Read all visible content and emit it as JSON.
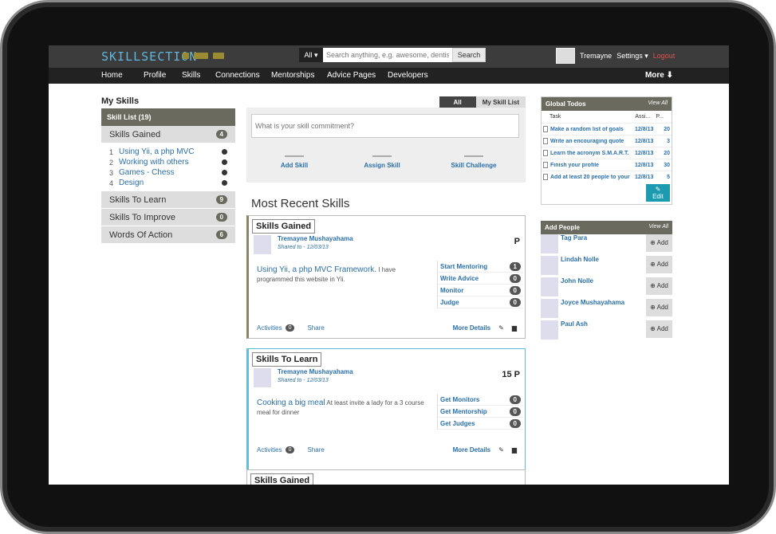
{
  "header": {
    "logo_text": "SKILLSECTION",
    "search_scope": "All ▾",
    "search_placeholder": "Search anything, e.g. awesome, dentist",
    "search_button": "Search",
    "username": "Tremayne",
    "settings": "Settings ▾",
    "logout": "Logout"
  },
  "nav": {
    "items": [
      "Home",
      "Profile",
      "Skills",
      "Connections",
      "Mentorships",
      "Advice Pages",
      "Developers"
    ],
    "more": "More ⬇"
  },
  "left": {
    "title": "My Skills",
    "list_head": "Skill List (19)",
    "groups": [
      {
        "label": "Skills Gained",
        "count": "4"
      },
      {
        "label": "Skills To Learn",
        "count": "9"
      },
      {
        "label": "Skills To Improve",
        "count": "0"
      },
      {
        "label": "Words Of Action",
        "count": "6"
      }
    ],
    "sub_items": [
      {
        "num": "1",
        "label": "Using Yii, a php MVC"
      },
      {
        "num": "2",
        "label": "Working with others"
      },
      {
        "num": "3",
        "label": "Games - Chess"
      },
      {
        "num": "4",
        "label": "Design"
      }
    ]
  },
  "middle": {
    "toggle_all": "All",
    "toggle_my": "My Skill List",
    "commit_placeholder": "What is your skill commitment?",
    "actions": [
      "Add Skill",
      "Assign Skill",
      "Skill Challenge"
    ],
    "recent_title": "Most Recent Skills",
    "cards": [
      {
        "tag": "Skills Gained",
        "name": "Tremayne Mushayahama",
        "shared": "Shared to - 12/03/13",
        "pin": "P",
        "title": "Using Yii, a php MVC Framework.",
        "body": " I have programmed this website in Yii.",
        "options": [
          {
            "label": "Start Mentoring",
            "count": "1"
          },
          {
            "label": "Write Advice",
            "count": "0"
          },
          {
            "label": "Monitor",
            "count": "0"
          },
          {
            "label": "Judge",
            "count": "0"
          }
        ],
        "activities": "Activities",
        "activities_count": "0",
        "share": "Share",
        "more": "More Details"
      },
      {
        "tag": "Skills To Learn",
        "name": "Tremayne Mushayahama",
        "shared": "Shared to - 12/03/13",
        "pin": "15 P",
        "title": "Cooking a big meal",
        "body": " At least invite a lady for a 3 course meal for dinner",
        "options": [
          {
            "label": "Get Monitors",
            "count": "0"
          },
          {
            "label": "Get Mentorship",
            "count": "0"
          },
          {
            "label": "Get Judges",
            "count": "0"
          }
        ],
        "activities": "Activities",
        "activities_count": "0",
        "share": "Share",
        "more": "More Details"
      },
      {
        "tag": "Skills Gained"
      }
    ]
  },
  "right": {
    "todos_title": "Global Todos",
    "view_all": "View All",
    "col_task": "Task",
    "col_assign": "Assi...",
    "col_p": "P...",
    "todos": [
      {
        "task": "Make a random list of goals",
        "date": "12/8/13",
        "p": "20"
      },
      {
        "task": "Write an encouraging quote",
        "date": "12/8/13",
        "p": "3"
      },
      {
        "task": "Learn the acronym S.M.A.R.T.",
        "date": "12/8/13",
        "p": "20"
      },
      {
        "task": "Finish your profile",
        "date": "12/8/13",
        "p": "30"
      },
      {
        "task": "Add at least 20 people to your",
        "date": "12/8/13",
        "p": "5"
      }
    ],
    "edit": "✎ Edit",
    "people_title": "Add People",
    "add_label": "⊕ Add",
    "people": [
      "Tag Para",
      "Lindah Nolle",
      "John Nolle",
      "Joyce Mushayahama",
      "Paul Ash"
    ]
  }
}
